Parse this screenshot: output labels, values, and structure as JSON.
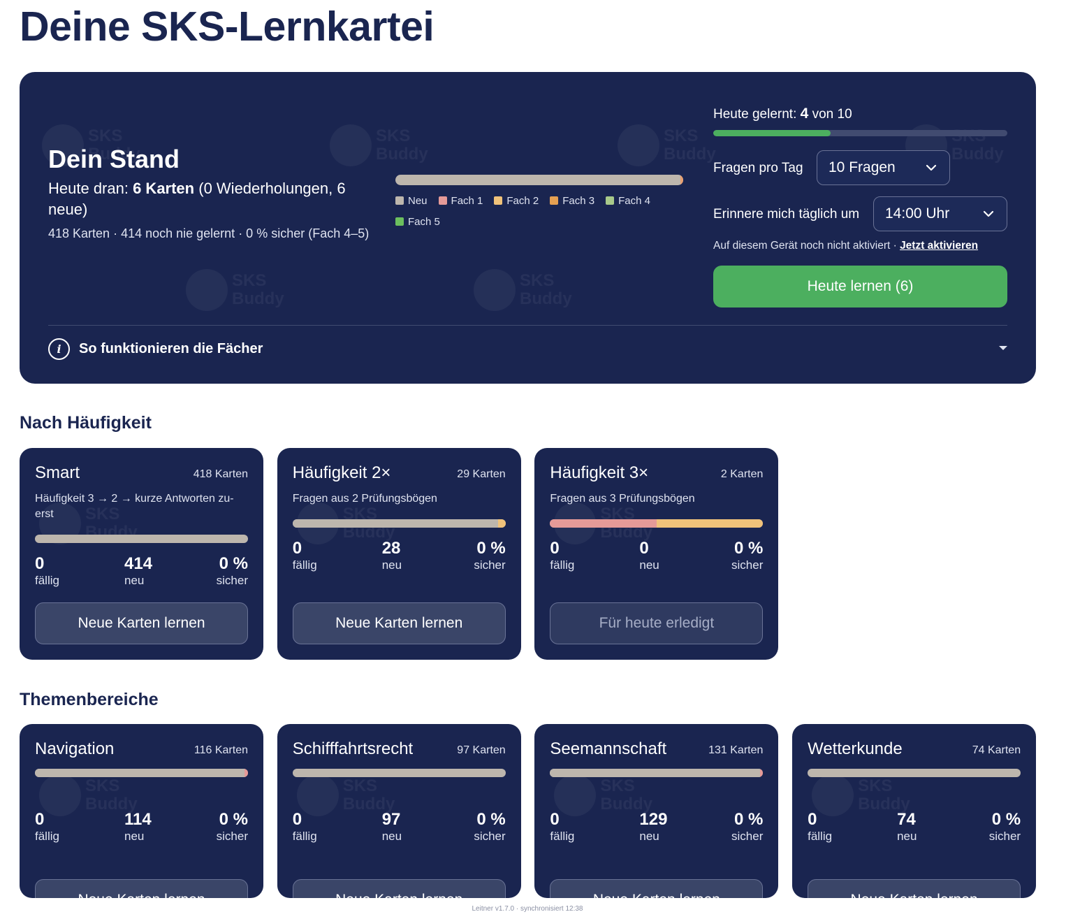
{
  "page": {
    "title": "Deine SKS-Lernkartei"
  },
  "watermark": {
    "line1": "SKS",
    "line2": "Buddy"
  },
  "status": {
    "heading": "Dein Stand",
    "today_prefix": "Heute dran: ",
    "today_bold": "6 Karten",
    "today_suffix": " (0 Wiederholungen, 6 neue)",
    "stats": "418 Karten · 414 noch nie gelernt · 0 % sicher (Fach 4–5)",
    "legend": [
      {
        "label": "Neu",
        "color": "#bdb6ad"
      },
      {
        "label": "Fach 1",
        "color": "#e59a98"
      },
      {
        "label": "Fach 2",
        "color": "#f0c27a"
      },
      {
        "label": "Fach 3",
        "color": "#e5a052"
      },
      {
        "label": "Fach 4",
        "color": "#a8c98a"
      },
      {
        "label": "Fach 5",
        "color": "#6cbf5e"
      }
    ],
    "learned_prefix": "Heute gelernt: ",
    "learned_done": "4",
    "learned_suffix": " von 10",
    "learned_fraction": 0.4,
    "questions_label": "Fragen pro Tag",
    "questions_value": "10 Fragen",
    "reminder_label": "Erinnere mich täglich um",
    "reminder_value": "14:00 Uhr",
    "notice_text": "Auf diesem Gerät noch nicht aktiviert · ",
    "notice_link": "Jetzt aktivieren",
    "primary_button": "Heute lernen (6)",
    "info_text": "So funktionieren die Fächer"
  },
  "sections": {
    "frequency_title": "Nach Häufigkeit",
    "topics_title": "Themenbereiche"
  },
  "frequency_cards": [
    {
      "title": "Smart",
      "count": "418 Karten",
      "desc": "Häufigkeit 3 → 2 → kurze Antworten zu­erst",
      "due": "0",
      "due_label": "fällig",
      "new": "414",
      "new_label": "neu",
      "safe": "0 %",
      "safe_label": "sicher",
      "button": "Neue Karten lernen",
      "bar": [
        {
          "share": 1.0,
          "color": "#bdb6ad"
        }
      ]
    },
    {
      "title": "Häufigkeit 2×",
      "count": "29 Karten",
      "desc": "Fragen aus 2 Prüfungsbögen",
      "due": "0",
      "due_label": "fällig",
      "new": "28",
      "new_label": "neu",
      "safe": "0 %",
      "safe_label": "sicher",
      "button": "Neue Karten lernen",
      "bar": [
        {
          "share": 0.966,
          "color": "#bdb6ad"
        },
        {
          "share": 0.034,
          "color": "#f0c27a"
        }
      ]
    },
    {
      "title": "Häufigkeit 3×",
      "count": "2 Karten",
      "desc": "Fragen aus 3 Prüfungsbögen",
      "due": "0",
      "due_label": "fällig",
      "new": "0",
      "new_label": "neu",
      "safe": "0 %",
      "safe_label": "sicher",
      "button": "Für heute erledigt",
      "bar": [
        {
          "share": 0.5,
          "color": "#e59a98"
        },
        {
          "share": 0.5,
          "color": "#f0c27a"
        }
      ]
    }
  ],
  "topic_cards": [
    {
      "title": "Navigation",
      "count": "116 Karten",
      "due": "0",
      "due_label": "fällig",
      "new": "114",
      "new_label": "neu",
      "safe": "0 %",
      "safe_label": "sicher",
      "button": "Neue Karten lernen",
      "bar": [
        {
          "share": 0.983,
          "color": "#bdb6ad"
        },
        {
          "share": 0.017,
          "color": "#e59a98"
        }
      ]
    },
    {
      "title": "Schifffahrtsrecht",
      "count": "97 Karten",
      "due": "0",
      "due_label": "fällig",
      "new": "97",
      "new_label": "neu",
      "safe": "0 %",
      "safe_label": "sicher",
      "button": "Neue Karten lernen",
      "bar": [
        {
          "share": 1.0,
          "color": "#bdb6ad"
        }
      ]
    },
    {
      "title": "Seemannschaft",
      "count": "131 Karten",
      "due": "0",
      "due_label": "fällig",
      "new": "129",
      "new_label": "neu",
      "safe": "0 %",
      "safe_label": "sicher",
      "button": "Neue Karten lernen",
      "bar": [
        {
          "share": 0.985,
          "color": "#bdb6ad"
        },
        {
          "share": 0.015,
          "color": "#e59a98"
        }
      ]
    },
    {
      "title": "Wetterkunde",
      "count": "74 Karten",
      "due": "0",
      "due_label": "fällig",
      "new": "74",
      "new_label": "neu",
      "safe": "0 %",
      "safe_label": "sicher",
      "button": "Neue Karten lernen",
      "bar": [
        {
          "share": 1.0,
          "color": "#bdb6ad"
        }
      ]
    }
  ],
  "footer": {
    "text": "Leitner v1.7.0 · synchronisiert 12:38"
  }
}
